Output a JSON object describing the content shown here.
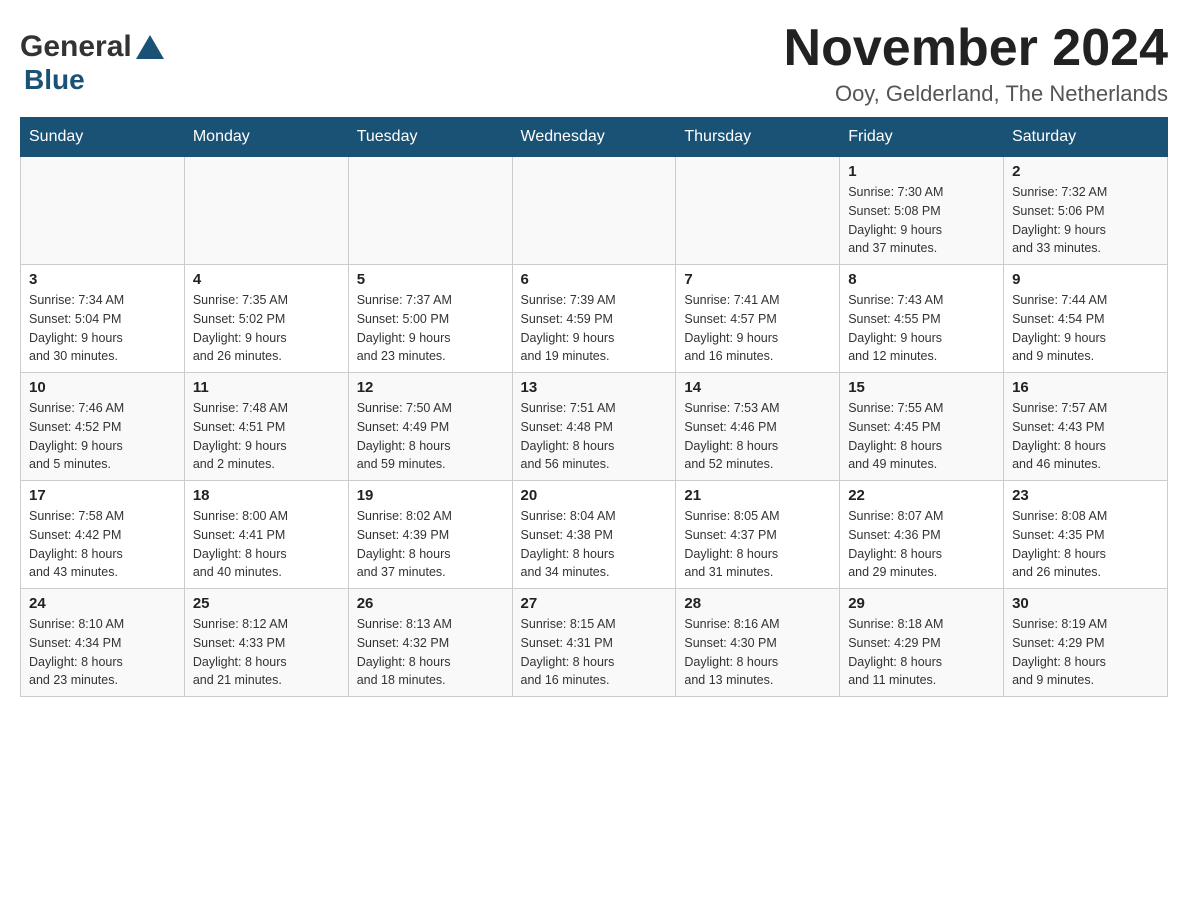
{
  "header": {
    "logo_general": "General",
    "logo_blue": "Blue",
    "month_title": "November 2024",
    "location": "Ooy, Gelderland, The Netherlands"
  },
  "weekdays": [
    "Sunday",
    "Monday",
    "Tuesday",
    "Wednesday",
    "Thursday",
    "Friday",
    "Saturday"
  ],
  "weeks": [
    {
      "days": [
        {
          "number": "",
          "info": ""
        },
        {
          "number": "",
          "info": ""
        },
        {
          "number": "",
          "info": ""
        },
        {
          "number": "",
          "info": ""
        },
        {
          "number": "",
          "info": ""
        },
        {
          "number": "1",
          "info": "Sunrise: 7:30 AM\nSunset: 5:08 PM\nDaylight: 9 hours\nand 37 minutes."
        },
        {
          "number": "2",
          "info": "Sunrise: 7:32 AM\nSunset: 5:06 PM\nDaylight: 9 hours\nand 33 minutes."
        }
      ]
    },
    {
      "days": [
        {
          "number": "3",
          "info": "Sunrise: 7:34 AM\nSunset: 5:04 PM\nDaylight: 9 hours\nand 30 minutes."
        },
        {
          "number": "4",
          "info": "Sunrise: 7:35 AM\nSunset: 5:02 PM\nDaylight: 9 hours\nand 26 minutes."
        },
        {
          "number": "5",
          "info": "Sunrise: 7:37 AM\nSunset: 5:00 PM\nDaylight: 9 hours\nand 23 minutes."
        },
        {
          "number": "6",
          "info": "Sunrise: 7:39 AM\nSunset: 4:59 PM\nDaylight: 9 hours\nand 19 minutes."
        },
        {
          "number": "7",
          "info": "Sunrise: 7:41 AM\nSunset: 4:57 PM\nDaylight: 9 hours\nand 16 minutes."
        },
        {
          "number": "8",
          "info": "Sunrise: 7:43 AM\nSunset: 4:55 PM\nDaylight: 9 hours\nand 12 minutes."
        },
        {
          "number": "9",
          "info": "Sunrise: 7:44 AM\nSunset: 4:54 PM\nDaylight: 9 hours\nand 9 minutes."
        }
      ]
    },
    {
      "days": [
        {
          "number": "10",
          "info": "Sunrise: 7:46 AM\nSunset: 4:52 PM\nDaylight: 9 hours\nand 5 minutes."
        },
        {
          "number": "11",
          "info": "Sunrise: 7:48 AM\nSunset: 4:51 PM\nDaylight: 9 hours\nand 2 minutes."
        },
        {
          "number": "12",
          "info": "Sunrise: 7:50 AM\nSunset: 4:49 PM\nDaylight: 8 hours\nand 59 minutes."
        },
        {
          "number": "13",
          "info": "Sunrise: 7:51 AM\nSunset: 4:48 PM\nDaylight: 8 hours\nand 56 minutes."
        },
        {
          "number": "14",
          "info": "Sunrise: 7:53 AM\nSunset: 4:46 PM\nDaylight: 8 hours\nand 52 minutes."
        },
        {
          "number": "15",
          "info": "Sunrise: 7:55 AM\nSunset: 4:45 PM\nDaylight: 8 hours\nand 49 minutes."
        },
        {
          "number": "16",
          "info": "Sunrise: 7:57 AM\nSunset: 4:43 PM\nDaylight: 8 hours\nand 46 minutes."
        }
      ]
    },
    {
      "days": [
        {
          "number": "17",
          "info": "Sunrise: 7:58 AM\nSunset: 4:42 PM\nDaylight: 8 hours\nand 43 minutes."
        },
        {
          "number": "18",
          "info": "Sunrise: 8:00 AM\nSunset: 4:41 PM\nDaylight: 8 hours\nand 40 minutes."
        },
        {
          "number": "19",
          "info": "Sunrise: 8:02 AM\nSunset: 4:39 PM\nDaylight: 8 hours\nand 37 minutes."
        },
        {
          "number": "20",
          "info": "Sunrise: 8:04 AM\nSunset: 4:38 PM\nDaylight: 8 hours\nand 34 minutes."
        },
        {
          "number": "21",
          "info": "Sunrise: 8:05 AM\nSunset: 4:37 PM\nDaylight: 8 hours\nand 31 minutes."
        },
        {
          "number": "22",
          "info": "Sunrise: 8:07 AM\nSunset: 4:36 PM\nDaylight: 8 hours\nand 29 minutes."
        },
        {
          "number": "23",
          "info": "Sunrise: 8:08 AM\nSunset: 4:35 PM\nDaylight: 8 hours\nand 26 minutes."
        }
      ]
    },
    {
      "days": [
        {
          "number": "24",
          "info": "Sunrise: 8:10 AM\nSunset: 4:34 PM\nDaylight: 8 hours\nand 23 minutes."
        },
        {
          "number": "25",
          "info": "Sunrise: 8:12 AM\nSunset: 4:33 PM\nDaylight: 8 hours\nand 21 minutes."
        },
        {
          "number": "26",
          "info": "Sunrise: 8:13 AM\nSunset: 4:32 PM\nDaylight: 8 hours\nand 18 minutes."
        },
        {
          "number": "27",
          "info": "Sunrise: 8:15 AM\nSunset: 4:31 PM\nDaylight: 8 hours\nand 16 minutes."
        },
        {
          "number": "28",
          "info": "Sunrise: 8:16 AM\nSunset: 4:30 PM\nDaylight: 8 hours\nand 13 minutes."
        },
        {
          "number": "29",
          "info": "Sunrise: 8:18 AM\nSunset: 4:29 PM\nDaylight: 8 hours\nand 11 minutes."
        },
        {
          "number": "30",
          "info": "Sunrise: 8:19 AM\nSunset: 4:29 PM\nDaylight: 8 hours\nand 9 minutes."
        }
      ]
    }
  ]
}
